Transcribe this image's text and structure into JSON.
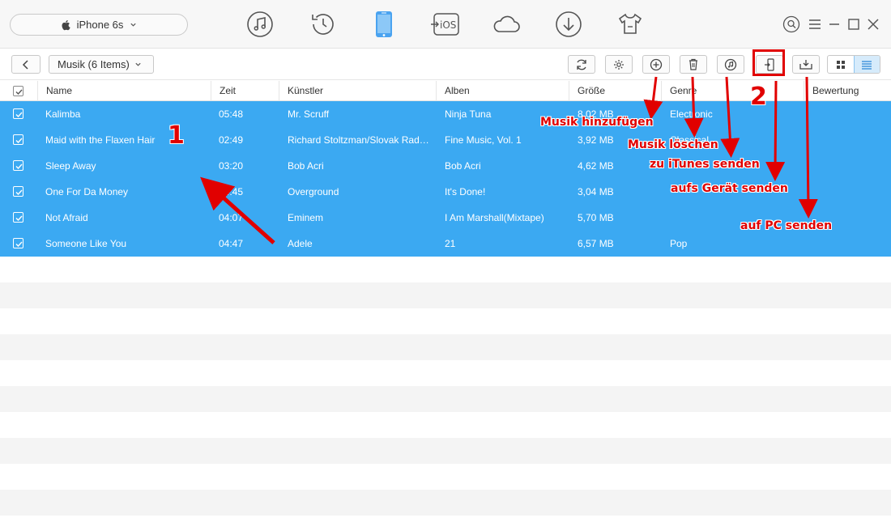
{
  "device": {
    "name": "iPhone 6s"
  },
  "categories": [
    "music-icon",
    "history-icon",
    "phone-icon",
    "ios-transfer-icon",
    "cloud-icon",
    "download-icon",
    "shirt-icon"
  ],
  "categories_labels": {
    "ios": "iOS"
  },
  "toolbar": {
    "dropdown_label": "Musik (6 Items)"
  },
  "columns": [
    "Name",
    "Zeit",
    "Künstler",
    "Alben",
    "Größe",
    "Genre",
    "Bewertung"
  ],
  "rows": [
    {
      "name": "Kalimba",
      "time": "05:48",
      "artist": "Mr. Scruff",
      "album": "Ninja Tuna",
      "size": "8,02 MB",
      "genre": "Electronic"
    },
    {
      "name": "Maid with the Flaxen Hair",
      "time": "02:49",
      "artist": "Richard Stoltzman/Slovak Radi...",
      "album": "Fine Music, Vol. 1",
      "size": "3,92 MB",
      "genre": "Classical"
    },
    {
      "name": "Sleep Away",
      "time": "03:20",
      "artist": "Bob Acri",
      "album": "Bob Acri",
      "size": "4,62 MB",
      "genre": ""
    },
    {
      "name": "One For Da Money",
      "time": "04:45",
      "artist": "Overground",
      "album": "It's Done!",
      "size": "3,04 MB",
      "genre": ""
    },
    {
      "name": "Not Afraid",
      "time": "04:07",
      "artist": "Eminem",
      "album": "I Am Marshall(Mixtape)",
      "size": "5,70 MB",
      "genre": ""
    },
    {
      "name": "Someone Like You",
      "time": "04:47",
      "artist": "Adele",
      "album": "21",
      "size": "6,57 MB",
      "genre": "Pop"
    }
  ],
  "annotations": {
    "step1": "1",
    "step2": "2",
    "add_music": "Musik hinzufügen",
    "delete_music": "Musik löschen",
    "to_itunes": "zu iTunes senden",
    "to_device": "aufs Gerät senden",
    "to_pc": "auf PC senden"
  },
  "colors": {
    "selected_row": "#3ba9f2",
    "annotation": "#e10000",
    "active_category": "#4aa3f0"
  }
}
